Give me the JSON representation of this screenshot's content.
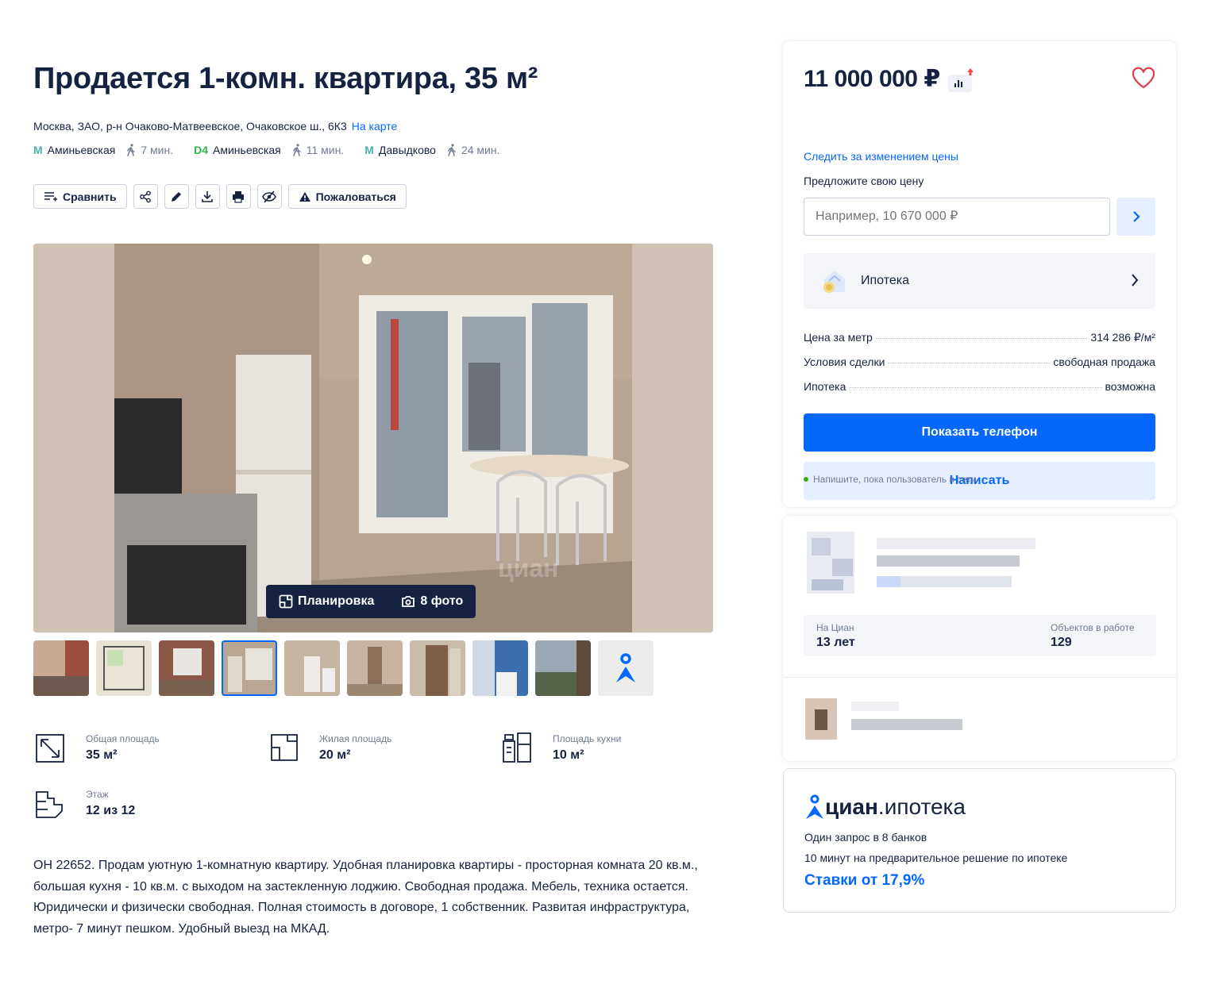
{
  "listing": {
    "title": "Продается 1-комн. квартира, 35 м²",
    "address": "Москва, ЗАО, р-н Очаково-Матвеевское, Очаковское ш., 6К3",
    "map_link": "На карте",
    "metro": [
      {
        "line": "M",
        "line_color": "#4fb3b0",
        "name": "Аминьевская",
        "walk": "7 мин."
      },
      {
        "line": "D4",
        "line_color": "#34b34a",
        "name": "Аминьевская",
        "walk": "11 мин."
      },
      {
        "line": "M",
        "line_color": "#4fb3b0",
        "name": "Давыдково",
        "walk": "24 мин."
      }
    ]
  },
  "actions": {
    "compare": "Сравнить",
    "complain": "Пожаловаться"
  },
  "gallery": {
    "plan_label": "Планировка",
    "photos_label": "8 фото",
    "watermark": "циан"
  },
  "facts": {
    "total_area_label": "Общая площадь",
    "total_area": "35 м²",
    "living_area_label": "Жилая площадь",
    "living_area": "20 м²",
    "kitchen_area_label": "Площадь кухни",
    "kitchen_area": "10 м²",
    "floor_label": "Этаж",
    "floor": "12 из 12"
  },
  "description": "ОН 22652. Продам уютную 1-комнатную квартиру. Удобная планировка квартиры - просторная комната 20 кв.м., большая кухня - 10 кв.м. с выходом на застекленную лоджию. Свободная продажа. Мебель, техника остается. Юридически и физически свободная. Полная стоимость в договоре, 1 собственник. Развитая инфраструктура, метро- 7 минут пешком. Удобный выезд на МКАД.",
  "price_card": {
    "price": "11 000 000 ₽",
    "follow": "Следить за изменением цены",
    "offer_label": "Предложите свою цену",
    "offer_placeholder": "Например, 10 670 000 ₽",
    "mortgage": "Ипотека",
    "rows": [
      {
        "k": "Цена за метр",
        "v": "314 286 ₽/м²"
      },
      {
        "k": "Условия сделки",
        "v": "свободная продажа"
      },
      {
        "k": "Ипотека",
        "v": "возможна"
      }
    ],
    "show_phone": "Показать телефон",
    "write": "Написать",
    "online": "Напишите, пока пользователь в сети"
  },
  "agent": {
    "on_cian_label": "На Циан",
    "on_cian": "13 лет",
    "objects_label": "Объектов в работе",
    "objects": "129"
  },
  "mortgage_promo": {
    "brand": "циан",
    "brand_sub": ".ипотека",
    "line1": "Один запрос в 8 банков",
    "line2": "10 минут на предварительное решение по ипотеке",
    "rate": "Ставки от 17,9%"
  },
  "colors": {
    "accent": "#0468ff",
    "accent_light": "#e6efff",
    "text": "#152242",
    "muted": "#707a95"
  }
}
